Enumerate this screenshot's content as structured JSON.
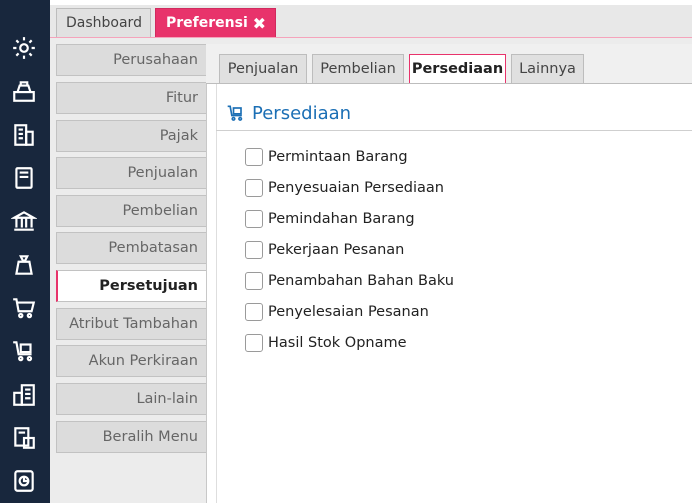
{
  "window_tabs": [
    {
      "label": "Dashboard"
    },
    {
      "label": "Preferensi",
      "close": "✖"
    }
  ],
  "sidebar": {
    "items": [
      {
        "label": "Perusahaan"
      },
      {
        "label": "Fitur"
      },
      {
        "label": "Pajak"
      },
      {
        "label": "Penjualan"
      },
      {
        "label": "Pembelian"
      },
      {
        "label": "Pembatasan"
      },
      {
        "label": "Persetujuan",
        "active": true
      },
      {
        "label": "Atribut Tambahan"
      },
      {
        "label": "Akun Perkiraan"
      },
      {
        "label": "Lain-lain"
      },
      {
        "label": "Beralih Menu"
      }
    ]
  },
  "subtabs": [
    {
      "label": "Penjualan"
    },
    {
      "label": "Pembelian"
    },
    {
      "label": "Persediaan",
      "active": true
    },
    {
      "label": "Lainnya"
    }
  ],
  "section": {
    "title": "Persediaan",
    "icon": "cart-box-icon",
    "checkboxes": [
      {
        "label": "Permintaan Barang",
        "checked": false
      },
      {
        "label": "Penyesuaian Persediaan",
        "checked": false
      },
      {
        "label": "Pemindahan Barang",
        "checked": false
      },
      {
        "label": "Pekerjaan Pesanan",
        "checked": false
      },
      {
        "label": "Penambahan Bahan Baku",
        "checked": false
      },
      {
        "label": "Penyelesaian Pesanan",
        "checked": false
      },
      {
        "label": "Hasil Stok Opname",
        "checked": false
      }
    ]
  },
  "iconbar": [
    "gear-icon",
    "cash-register-icon",
    "building-icon",
    "ledger-book-icon",
    "bank-icon",
    "money-bag-icon",
    "cart-icon",
    "cart-box-icon",
    "company-icon",
    "tax-calculator-icon",
    "report-chart-icon"
  ],
  "colors": {
    "accent": "#e8336b",
    "iconbar": "#18273d",
    "title": "#1b6fb5"
  }
}
